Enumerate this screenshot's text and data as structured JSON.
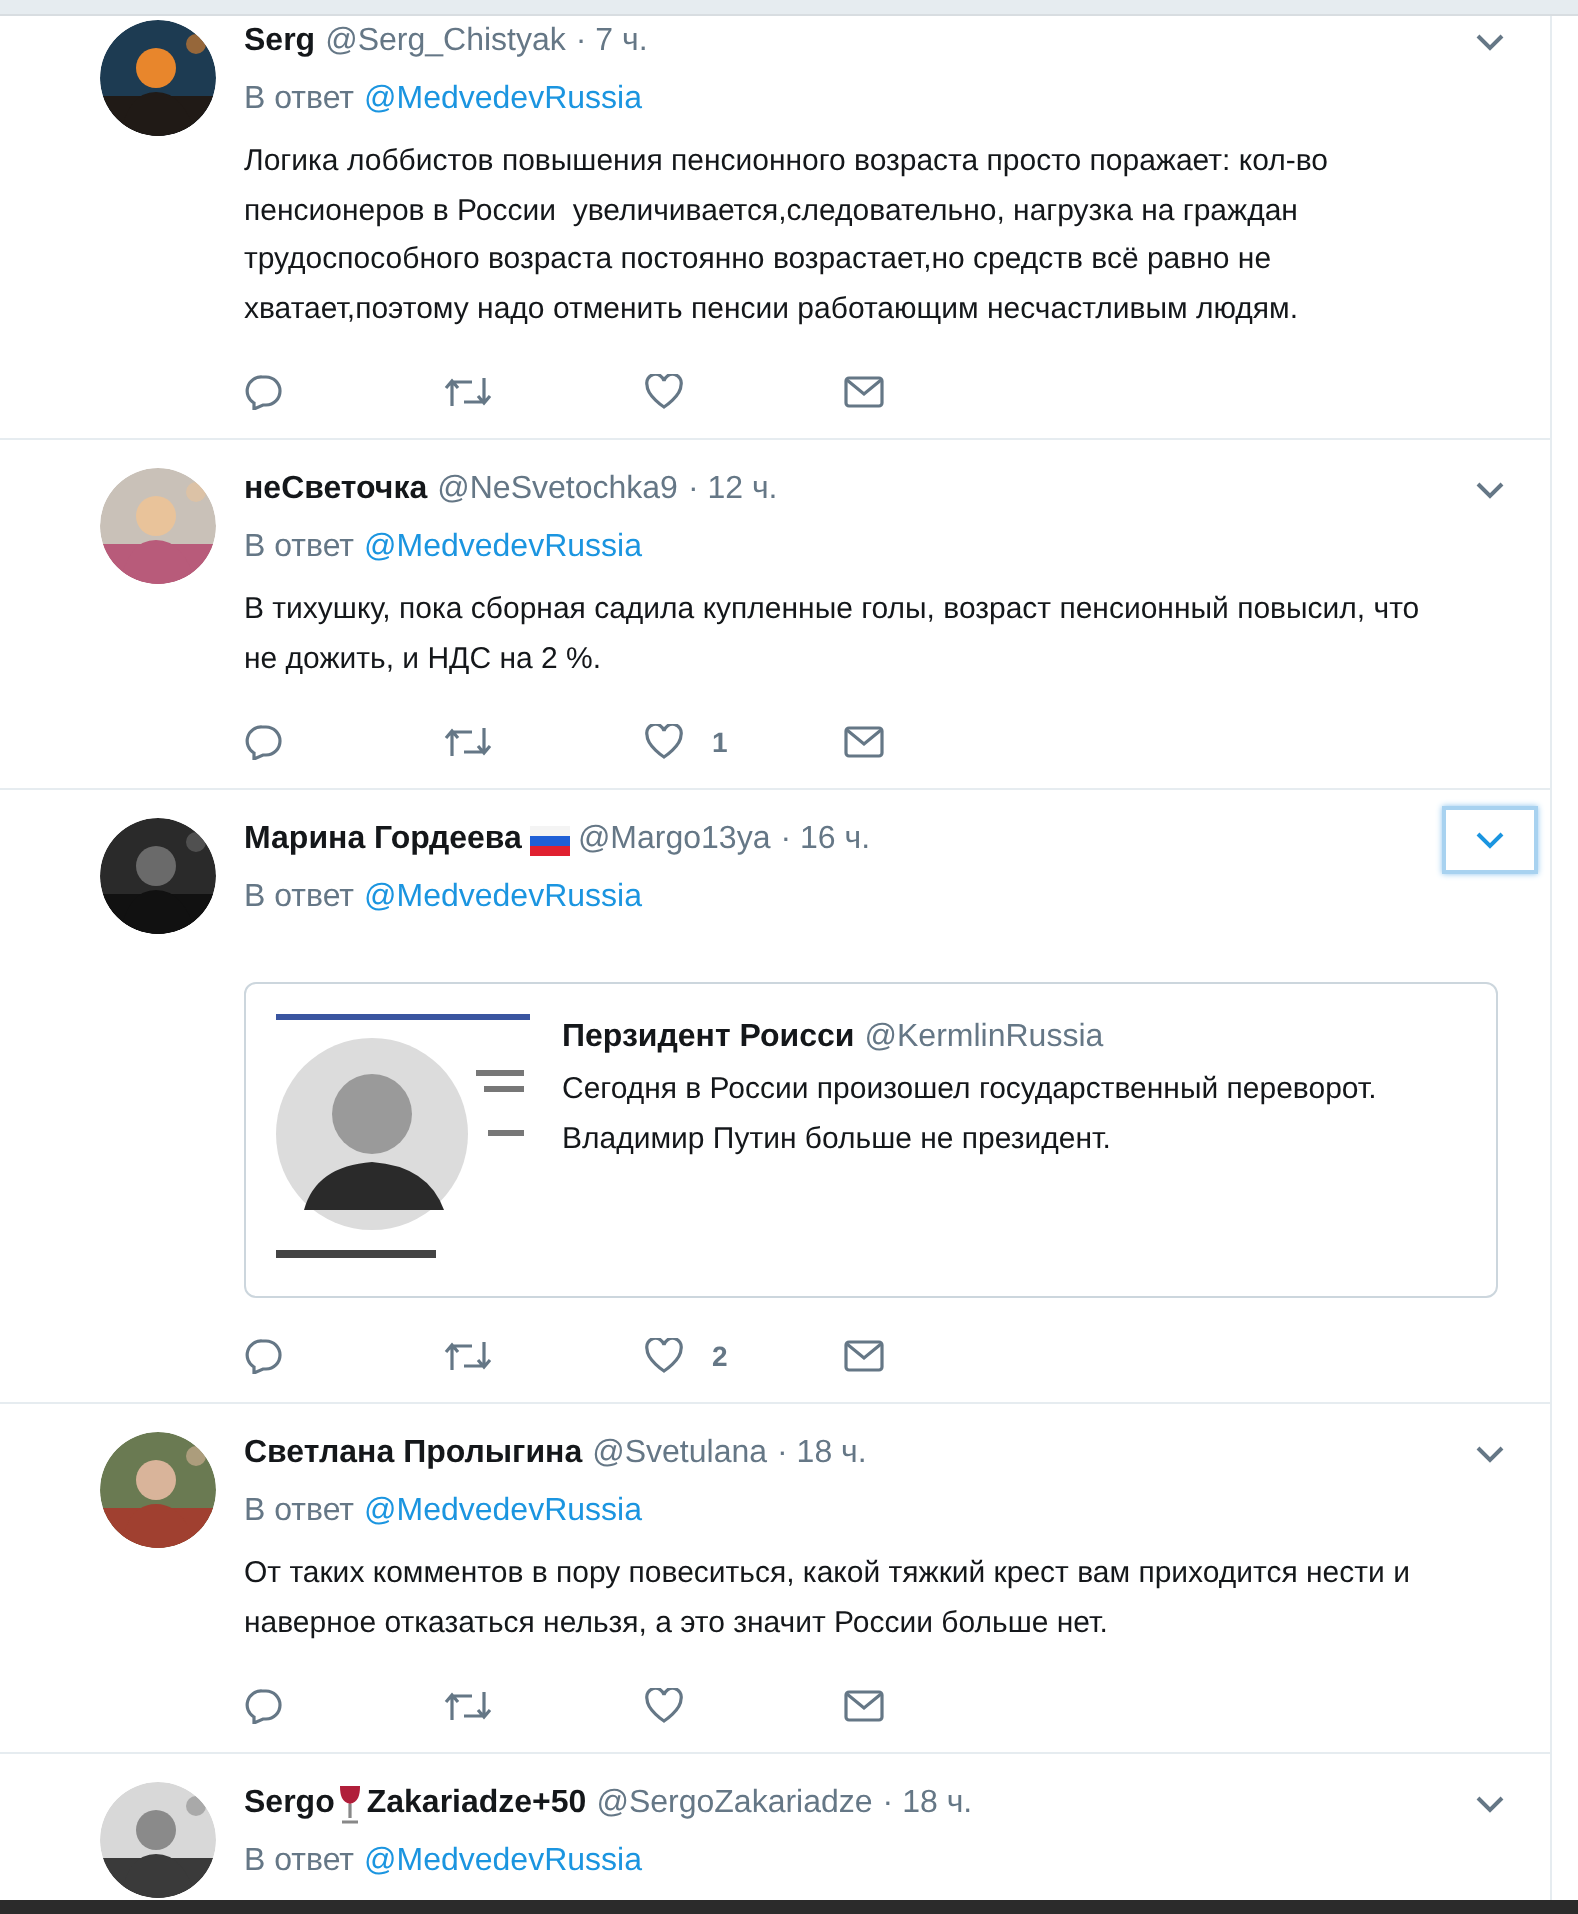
{
  "tweets": [
    {
      "name": "Serg",
      "handle": "@Serg_Chistyak",
      "time": "· 7 ч.",
      "reply_prefix": "В ответ",
      "reply_to": "@MedvedevRussia",
      "text": "Логика лоббистов повышения пенсионного возраста просто поражает: кол-во пенсионеров в России  увеличивается,следовательно, нагрузка на граждан трудоспособного возраста постоянно возрастает,но средств всё равно не хватает,поэтому надо отменить пенсии работающим несчастливым людям.",
      "menu_focused": false,
      "actions": [
        {
          "kind": "reply"
        },
        {
          "kind": "retweet"
        },
        {
          "kind": "like"
        },
        {
          "kind": "message"
        }
      ]
    },
    {
      "name": "неСветочка",
      "handle": "@NeSvetochka9",
      "time": "· 12 ч.",
      "reply_prefix": "В ответ",
      "reply_to": "@MedvedevRussia",
      "text": "В тихушку, пока сборная садила купленные голы, возраст пенсионный повысил, что не дожить, и НДС на 2 %.",
      "menu_focused": false,
      "actions": [
        {
          "kind": "reply"
        },
        {
          "kind": "retweet"
        },
        {
          "kind": "like",
          "count": "1"
        },
        {
          "kind": "message"
        }
      ]
    },
    {
      "name": "Марина Гордеева",
      "badge": {
        "kind": "flag"
      },
      "handle": "@Margo13ya",
      "time": "· 16 ч.",
      "reply_prefix": "В ответ",
      "reply_to": "@MedvedevRussia",
      "menu_focused": true,
      "quote": {
        "name": "Перзидент Роисси",
        "handle": "@KermlinRussia",
        "text": "Сегодня в России произошел государственный переворот. Владимир Путин больше не президент."
      },
      "actions": [
        {
          "kind": "reply"
        },
        {
          "kind": "retweet"
        },
        {
          "kind": "like",
          "count": "2"
        },
        {
          "kind": "message"
        }
      ]
    },
    {
      "name": "Светлана Пролыгина",
      "handle": "@Svetulana",
      "time": "· 18 ч.",
      "reply_prefix": "В ответ",
      "reply_to": "@MedvedevRussia",
      "text": "От таких комментов в пору повеситься, какой тяжкий крест вам приходится нести и наверное отказаться нельзя, а это значит России больше нет.",
      "menu_focused": false,
      "actions": [
        {
          "kind": "reply"
        },
        {
          "kind": "retweet"
        },
        {
          "kind": "like"
        },
        {
          "kind": "message"
        }
      ]
    },
    {
      "name": "Sergo",
      "badge": {
        "kind": "wine"
      },
      "name_after": "Zakariadze+50",
      "handle": "@SergoZakariadze",
      "time": "· 18 ч.",
      "reply_prefix": "В ответ",
      "reply_to": "@MedvedevRussia",
      "menu_focused": false
    }
  ]
}
